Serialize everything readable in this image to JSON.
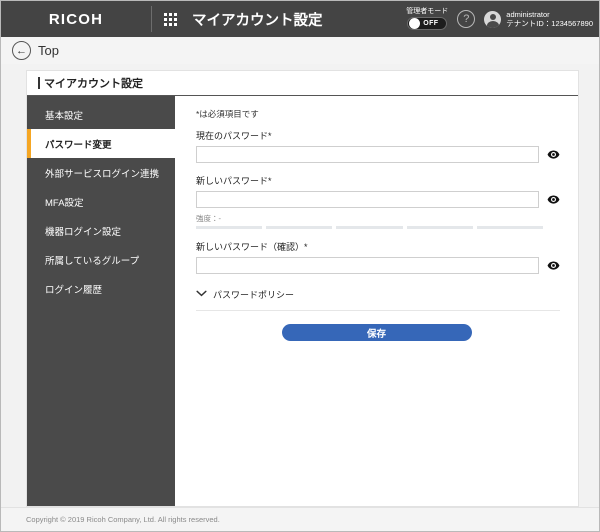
{
  "header": {
    "brand": "RICOH",
    "apps_icon": "grid-icon",
    "title": "マイアカウント設定",
    "admin_mode_label": "管理者モード",
    "admin_mode_state": "OFF",
    "help_icon": "?",
    "user_name": "administrator",
    "tenant": "テナントID：1234567890"
  },
  "topbar": {
    "back_icon": "←",
    "label": "Top"
  },
  "card": {
    "title": "マイアカウント設定"
  },
  "sidebar": {
    "items": [
      {
        "label": "基本設定",
        "active": false
      },
      {
        "label": "パスワード変更",
        "active": true
      },
      {
        "label": "外部サービスログイン連携",
        "active": false
      },
      {
        "label": "MFA設定",
        "active": false
      },
      {
        "label": "機器ログイン設定",
        "active": false
      },
      {
        "label": "所属しているグループ",
        "active": false
      },
      {
        "label": "ログイン履歴",
        "active": false
      }
    ]
  },
  "form": {
    "required_note": "*は必須項目です",
    "current_password": {
      "label": "現在のパスワード*",
      "value": "",
      "placeholder": "",
      "reveal_icon": "eye-icon"
    },
    "new_password": {
      "label": "新しいパスワード*",
      "value": "",
      "placeholder": "",
      "reveal_icon": "eye-icon",
      "strength_label": "強度：-",
      "strength_segments": 5,
      "strength_filled": 0
    },
    "confirm_password": {
      "label": "新しいパスワード（確認）*",
      "value": "",
      "placeholder": "",
      "reveal_icon": "eye-icon"
    },
    "policy": {
      "chevron": "⌄",
      "label": "パスワードポリシー",
      "expanded": false
    },
    "save_label": "保存"
  },
  "footer": {
    "copyright": "Copyright © 2019 Ricoh Company, Ltd. All rights reserved."
  },
  "colors": {
    "header_bg": "#444444",
    "sidebar_bg": "#4a4a4a",
    "accent": "#f5a623",
    "primary_button": "#3667b8"
  }
}
